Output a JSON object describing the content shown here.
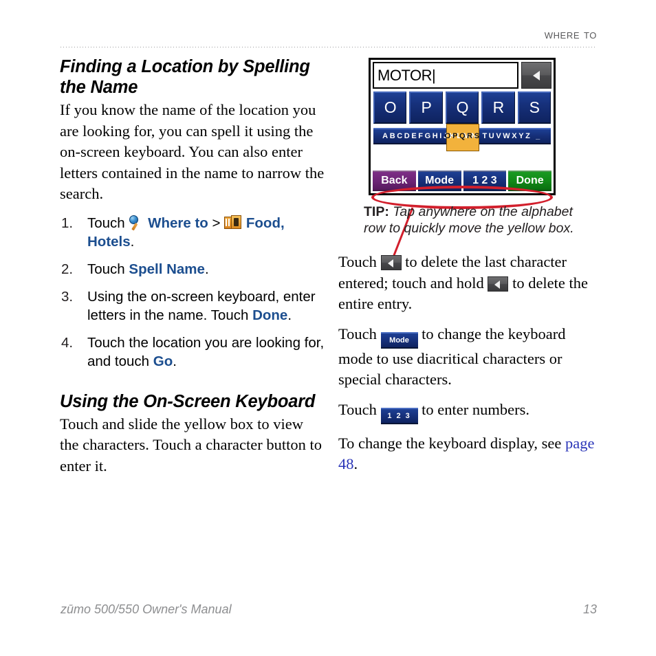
{
  "header": {
    "running_head": "Where To"
  },
  "left_column": {
    "heading1": "Finding a Location by Spelling the Name",
    "intro": "If you know the name of the location you are looking for, you can spell it using the on-screen keyboard. You can also enter letters contained in the name to narrow the search.",
    "steps": [
      {
        "number": "1.",
        "prefix": "Touch ",
        "icon1": "search-icon",
        "ui1": "Where to",
        "sep": " > ",
        "icon2": "food-hotels-icon",
        "ui2": "Food, Hotels",
        "suffix": "."
      },
      {
        "number": "2.",
        "prefix": "Touch ",
        "ui1": "Spell Name",
        "suffix": "."
      },
      {
        "number": "3.",
        "prefix": "Using the on-screen keyboard, enter letters in the name. Touch ",
        "ui1": "Done",
        "suffix": "."
      },
      {
        "number": "4.",
        "prefix": "Touch the location you are looking for, and touch ",
        "ui1": "Go",
        "suffix": "."
      }
    ],
    "heading2": "Using the On-Screen Keyboard",
    "para2": "Touch and slide the yellow box to view the characters. Touch a character button to enter it."
  },
  "device": {
    "entry_value": "MOTOR|",
    "backspace_icon": "backspace-triangle-icon",
    "keys": [
      "O",
      "P",
      "Q",
      "R",
      "S"
    ],
    "alphabet_row": "ABCDEFGHIJKLMN     TUVWXYZ _",
    "alphabet_highlight": "OPQRS",
    "bottom_buttons": [
      {
        "label": "Back",
        "color": "#6b2474"
      },
      {
        "label": "Mode",
        "color": "#16307a"
      },
      {
        "label": "1 2 3",
        "color": "#16307a"
      },
      {
        "label": "Done",
        "color": "#128a18"
      }
    ],
    "annotation_color": "#d21f2c"
  },
  "tip": {
    "label": "TIP:",
    "text": " Tap anywhere on the alphabet row to quickly move the yellow box."
  },
  "right_column": {
    "para1_a": "Touch ",
    "para1_b": " to delete the last character entered; touch and hold ",
    "para1_c": " to delete the entire entry.",
    "para2_a": "Touch ",
    "mode_button_label": "Mode",
    "para2_b": " to change the keyboard mode to use diacritical characters or special characters.",
    "para3_a": "Touch ",
    "num_button_label": "1 2 3",
    "para3_b": " to enter numbers.",
    "para4_a": "To change the keyboard display, see ",
    "link_text": "page 48",
    "para4_b": "."
  },
  "footer": {
    "left": "zūmo 500/550 Owner's Manual",
    "right": "13"
  }
}
